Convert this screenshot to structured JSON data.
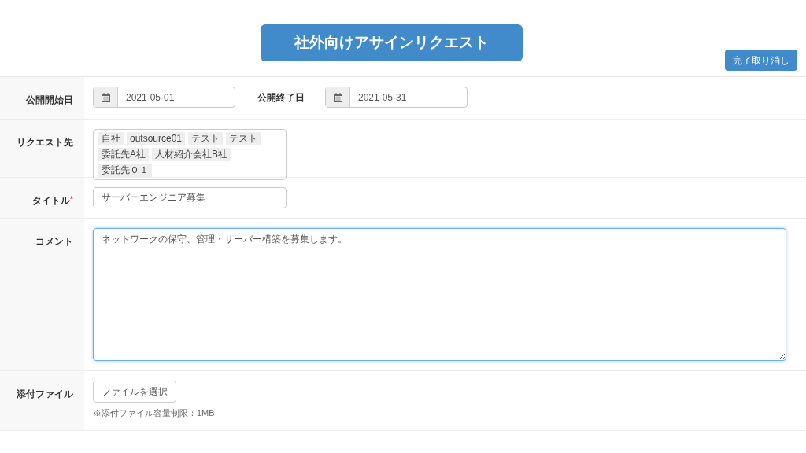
{
  "header": {
    "title": "社外向けアサインリクエスト",
    "cancel_button": "完了取り消し"
  },
  "form": {
    "start_date": {
      "label": "公開開始日",
      "value": "2021-05-01"
    },
    "end_date": {
      "label": "公開終了日",
      "value": "2021-05-31"
    },
    "request_to": {
      "label": "リクエスト先",
      "tags": [
        "自社",
        "outsource01",
        "テスト",
        "テスト",
        "委託先A社",
        "人材紹介会社B社",
        "委託先０１"
      ]
    },
    "title": {
      "label": "タイトル",
      "required_mark": "*",
      "value": "サーバーエンジニア募集"
    },
    "comment": {
      "label": "コメント",
      "value": "ネットワークの保守、管理・サーバー構築を募集します。",
      "focused": true
    },
    "attachment": {
      "label": "添付ファイル",
      "button": "ファイルを選択",
      "note": "※添付ファイル容量制限：1MB"
    }
  }
}
